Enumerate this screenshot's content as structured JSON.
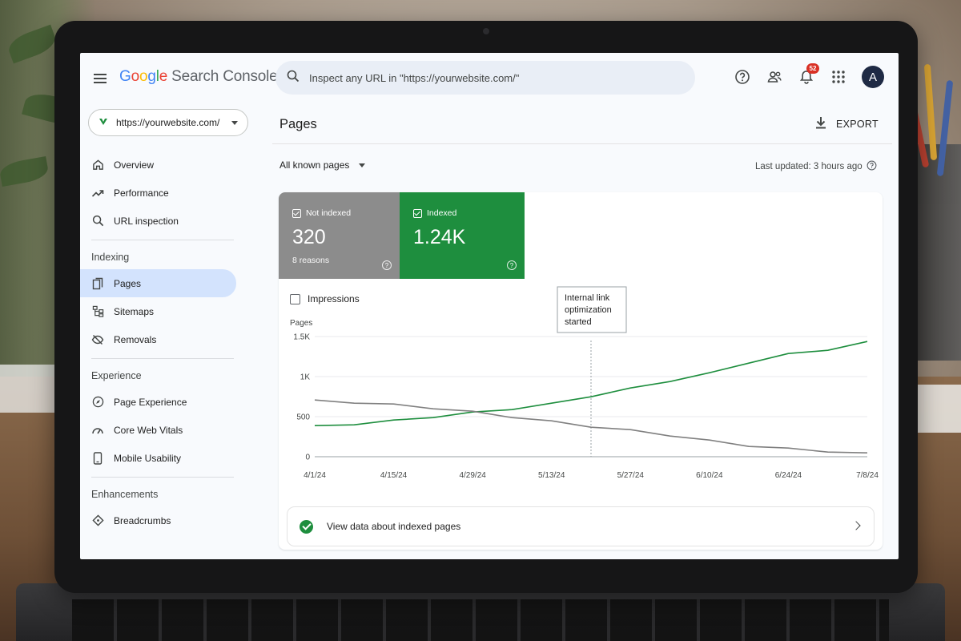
{
  "app": {
    "logo_google": [
      "G",
      "o",
      "o",
      "g",
      "l",
      "e"
    ],
    "logo_product": "Search Console",
    "search_placeholder": "Inspect any URL in \"https://yourwebsite.com/\"",
    "notification_count": "52",
    "avatar_initial": "A",
    "icons": [
      "menu-icon",
      "search-icon",
      "help-icon",
      "people-icon",
      "bell-icon",
      "apps-grid-icon"
    ]
  },
  "sidebar": {
    "property": "https://yourwebsite.com/",
    "top_items": [
      {
        "label": "Overview",
        "icon": "home-icon"
      },
      {
        "label": "Performance",
        "icon": "trending-up-icon"
      },
      {
        "label": "URL inspection",
        "icon": "search-icon"
      }
    ],
    "sections": [
      {
        "title": "Indexing",
        "items": [
          {
            "label": "Pages",
            "icon": "pages-icon",
            "active": true
          },
          {
            "label": "Sitemaps",
            "icon": "sitemap-icon"
          },
          {
            "label": "Removals",
            "icon": "removals-icon"
          }
        ]
      },
      {
        "title": "Experience",
        "items": [
          {
            "label": "Page Experience",
            "icon": "compass-icon"
          },
          {
            "label": "Core Web Vitals",
            "icon": "speed-icon"
          },
          {
            "label": "Mobile Usability",
            "icon": "phone-icon"
          }
        ]
      },
      {
        "title": "Enhancements",
        "items": [
          {
            "label": "Breadcrumbs",
            "icon": "diamond-icon"
          }
        ]
      }
    ]
  },
  "main": {
    "title": "Pages",
    "export_label": "EXPORT",
    "filter_label": "All known pages",
    "last_updated": "Last updated: 3 hours ago",
    "tiles": {
      "not_indexed": {
        "label": "Not indexed",
        "value": "320",
        "sub": "8 reasons",
        "color": "#8c8c8c"
      },
      "indexed": {
        "label": "Indexed",
        "value": "1.24K",
        "color": "#1e8e3e"
      }
    },
    "impressions_label": "Impressions",
    "view_link": "View data about indexed pages"
  },
  "chart_data": {
    "type": "line",
    "ylabel": "Pages",
    "y_ticks": [
      "0",
      "500",
      "1K",
      "1.5K"
    ],
    "ylim": [
      0,
      1500
    ],
    "x_ticks": [
      "4/1/24",
      "4/15/24",
      "4/29/24",
      "5/13/24",
      "5/27/24",
      "6/10/24",
      "6/24/24",
      "7/8/24"
    ],
    "x_range_days": [
      0,
      98
    ],
    "grid": true,
    "annotation": {
      "text": [
        "Internal link",
        "optimization",
        "started"
      ],
      "x_day": 49
    },
    "series": [
      {
        "name": "Indexed",
        "color": "#1e8e3e",
        "x_day": [
          0,
          7,
          14,
          21,
          28,
          35,
          42,
          49,
          56,
          63,
          70,
          77,
          84,
          91,
          98
        ],
        "values": [
          380,
          410,
          450,
          500,
          550,
          600,
          660,
          760,
          850,
          950,
          1040,
          1180,
          1280,
          1340,
          1430
        ]
      },
      {
        "name": "Not indexed",
        "color": "#808080",
        "x_day": [
          0,
          7,
          14,
          21,
          28,
          35,
          42,
          49,
          56,
          63,
          70,
          77,
          84,
          91,
          98
        ],
        "values": [
          700,
          680,
          650,
          610,
          560,
          500,
          440,
          380,
          330,
          270,
          200,
          140,
          100,
          70,
          40
        ]
      }
    ]
  }
}
